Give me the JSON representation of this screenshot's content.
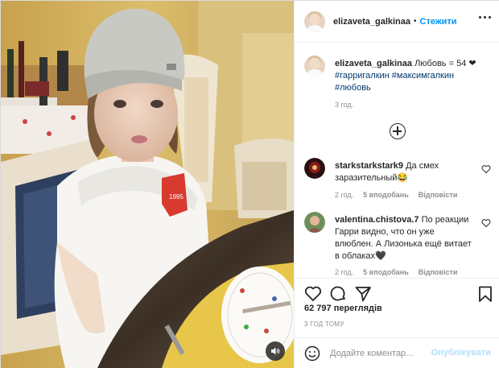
{
  "post": {
    "username": "elizaveta_galkinaa",
    "separator": "•",
    "follow_label": "Стежити",
    "caption": {
      "username": "elizaveta_galkinaa",
      "text": "Любовь = 54 ❤",
      "hashtags": [
        "#гарригалкин",
        "#максимгалкин",
        "#любовь"
      ],
      "time": "3 год."
    },
    "comments": [
      {
        "username": "starkstarkstark9",
        "text": "Да смех заразительный😂",
        "time": "2 год.",
        "likes": "5 вподобань",
        "reply_label": "Відповісти",
        "avatar_color": "#8b1a1a"
      },
      {
        "username": "valentina.chistova.7",
        "text": "По реакции Гарри видно, что он уже влюблен. А Лизонька ещё витает в облаках🖤",
        "time": "2 год.",
        "likes": "5 вподобань",
        "reply_label": "Відповісти",
        "avatar_color": "#b58a6a"
      }
    ],
    "likes_count": "62 797 переглядів",
    "ago": "3 ГОД ТОМУ",
    "add_comment_placeholder": "Додайте коментар...",
    "publish_label": "Опублікувати"
  },
  "icons": {
    "like": "heart-icon",
    "comment": "comment-icon",
    "share": "send-icon",
    "save": "bookmark-icon",
    "emoji": "smile-icon",
    "sound": "speaker-icon",
    "load_more": "plus-circle-icon",
    "more": "more-dots-icon"
  },
  "colors": {
    "link": "#0095f6",
    "hashtag": "#00376b",
    "muted": "#8e8e8e",
    "publish_disabled": "#b2dffc"
  }
}
